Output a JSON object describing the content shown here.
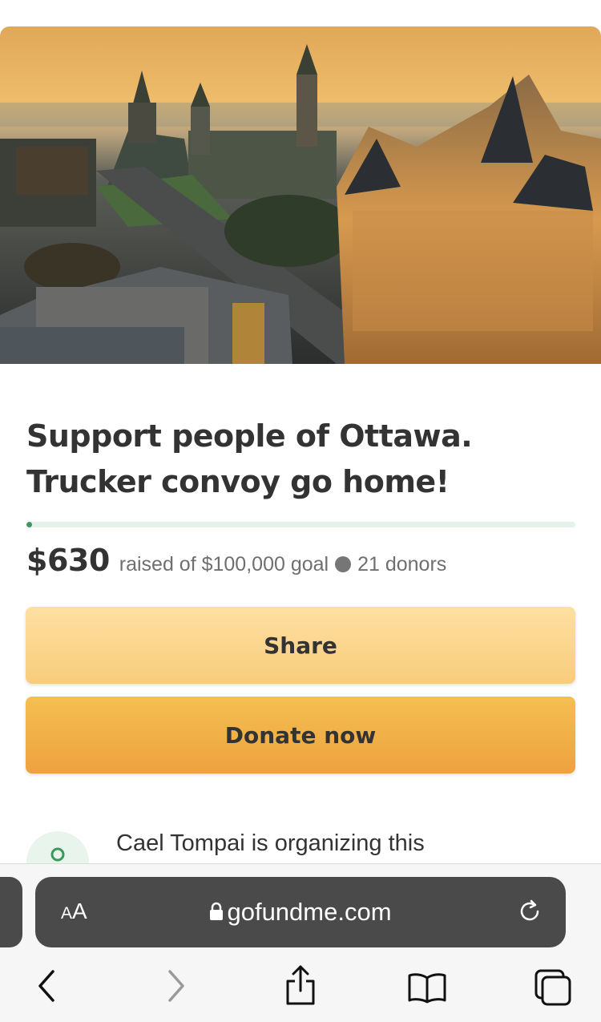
{
  "campaign": {
    "title_line1": "Support people of Ottawa.",
    "title_line2": "Trucker convoy go home!",
    "amount_raised": "$630",
    "goal_text": "raised of $100,000 goal",
    "donors_text": "21 donors",
    "progress_fraction": 0.0063
  },
  "actions": {
    "share_label": "Share",
    "donate_label": "Donate now"
  },
  "organizer": {
    "text": "Cael Tompai is organizing this"
  },
  "browser": {
    "text_size_label_small": "A",
    "text_size_label_large": "A",
    "url": "gofundme.com"
  },
  "colors": {
    "progress": "#3a9a5e",
    "share_button": "#f9cc7c",
    "donate_button": "#eea23f"
  }
}
